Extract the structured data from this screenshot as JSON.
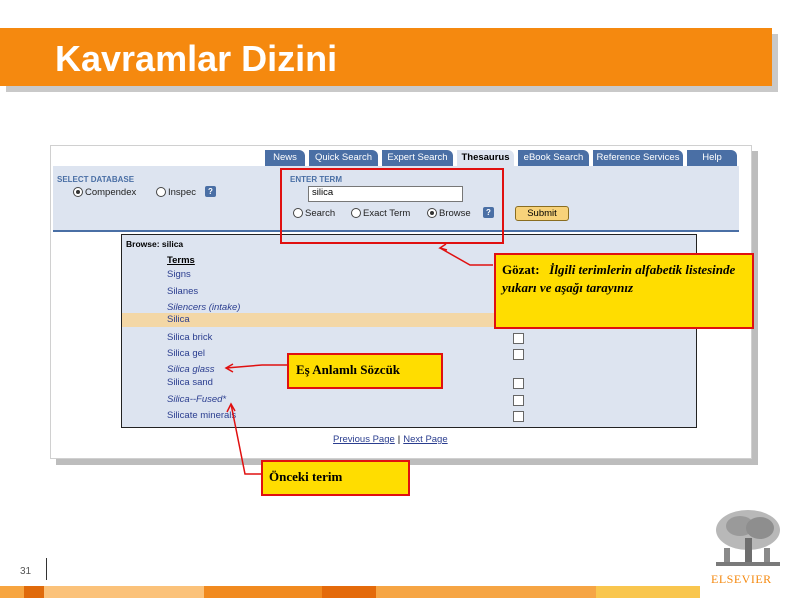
{
  "slide": {
    "title": "Kavramlar Dizini",
    "page_number": "31"
  },
  "tabs": [
    "News",
    "Quick Search",
    "Expert Search",
    "Thesaurus",
    "eBook Search",
    "Reference Services",
    "Help"
  ],
  "active_tab": "Thesaurus",
  "select_database": {
    "label": "SELECT DATABASE",
    "options": [
      "Compendex",
      "Inspec"
    ],
    "selected": "Compendex"
  },
  "enter_term": {
    "label": "ENTER TERM",
    "value": "silica",
    "options": [
      "Search",
      "Exact Term",
      "Browse"
    ],
    "selected": "Browse",
    "submit_label": "Submit"
  },
  "browse": {
    "title": "Browse: silica",
    "header": "Terms",
    "terms": [
      {
        "text": "Signs",
        "italic": false,
        "highlight": false,
        "checkbox": false
      },
      {
        "text": "Silanes",
        "italic": false,
        "highlight": false,
        "checkbox": false
      },
      {
        "text": "Silencers (intake)",
        "italic": true,
        "highlight": false,
        "checkbox": false
      },
      {
        "text": "Silica",
        "italic": false,
        "highlight": true,
        "checkbox": false
      },
      {
        "text": "Silica brick",
        "italic": false,
        "highlight": false,
        "checkbox": true
      },
      {
        "text": "Silica gel",
        "italic": false,
        "highlight": false,
        "checkbox": true
      },
      {
        "text": "Silica glass",
        "italic": true,
        "highlight": false,
        "checkbox": false
      },
      {
        "text": "Silica sand",
        "italic": false,
        "highlight": false,
        "checkbox": true
      },
      {
        "text": "Silica--Fused*",
        "italic": true,
        "highlight": false,
        "checkbox": true
      },
      {
        "text": "Silicate minerals",
        "italic": false,
        "highlight": false,
        "checkbox": true
      }
    ],
    "previous_page": "Previous Page",
    "separator": "|",
    "next_page": "Next Page"
  },
  "callouts": {
    "browse_label": "Gözat:",
    "browse_desc": "İlgili terimlerin alfabetik listesinde yukarı ve aşağı tarayınız",
    "synonym": "Eş Anlamlı Sözcük",
    "previous_term": "Önceki terim"
  },
  "logo": {
    "text": "ELSEVIER"
  },
  "colors": {
    "accent": "#f5890f",
    "tab_blue": "#4a6fa5",
    "panel_bg": "#dde4f0",
    "callout_bg": "#ffdd00",
    "callout_border": "#e01010"
  }
}
